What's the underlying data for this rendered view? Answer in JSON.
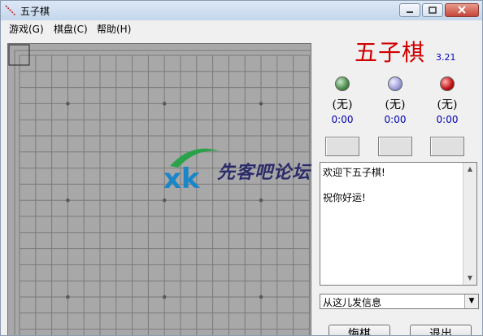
{
  "window": {
    "title": "五子棋"
  },
  "menu": {
    "items": [
      "游戏(G)",
      "棋盘(C)",
      "帮助(H)"
    ]
  },
  "board": {
    "lines": 19,
    "star_points": [
      [
        3,
        3
      ],
      [
        3,
        9
      ],
      [
        3,
        15
      ],
      [
        9,
        3
      ],
      [
        9,
        9
      ],
      [
        9,
        15
      ],
      [
        15,
        3
      ],
      [
        15,
        9
      ],
      [
        15,
        15
      ]
    ],
    "color": "#a8a8a8"
  },
  "panel": {
    "title": "五子棋",
    "version": "3.21",
    "players": [
      {
        "name": "(无)",
        "time": "0:00",
        "stone_color": "#4a8a4a",
        "icon": "green-stone-icon"
      },
      {
        "name": "(无)",
        "time": "0:00",
        "stone_color": "#9a9ad8",
        "icon": "blue-stone-icon"
      },
      {
        "name": "(无)",
        "time": "0:00",
        "stone_color": "#c01010",
        "icon": "red-stone-icon"
      }
    ],
    "messages": [
      "欢迎下五子棋!",
      "祝你好运!"
    ],
    "send_target": "从这儿发信息",
    "undo_label": "悔棋",
    "exit_label": "退出"
  },
  "watermark": {
    "text": "先客吧论坛"
  }
}
